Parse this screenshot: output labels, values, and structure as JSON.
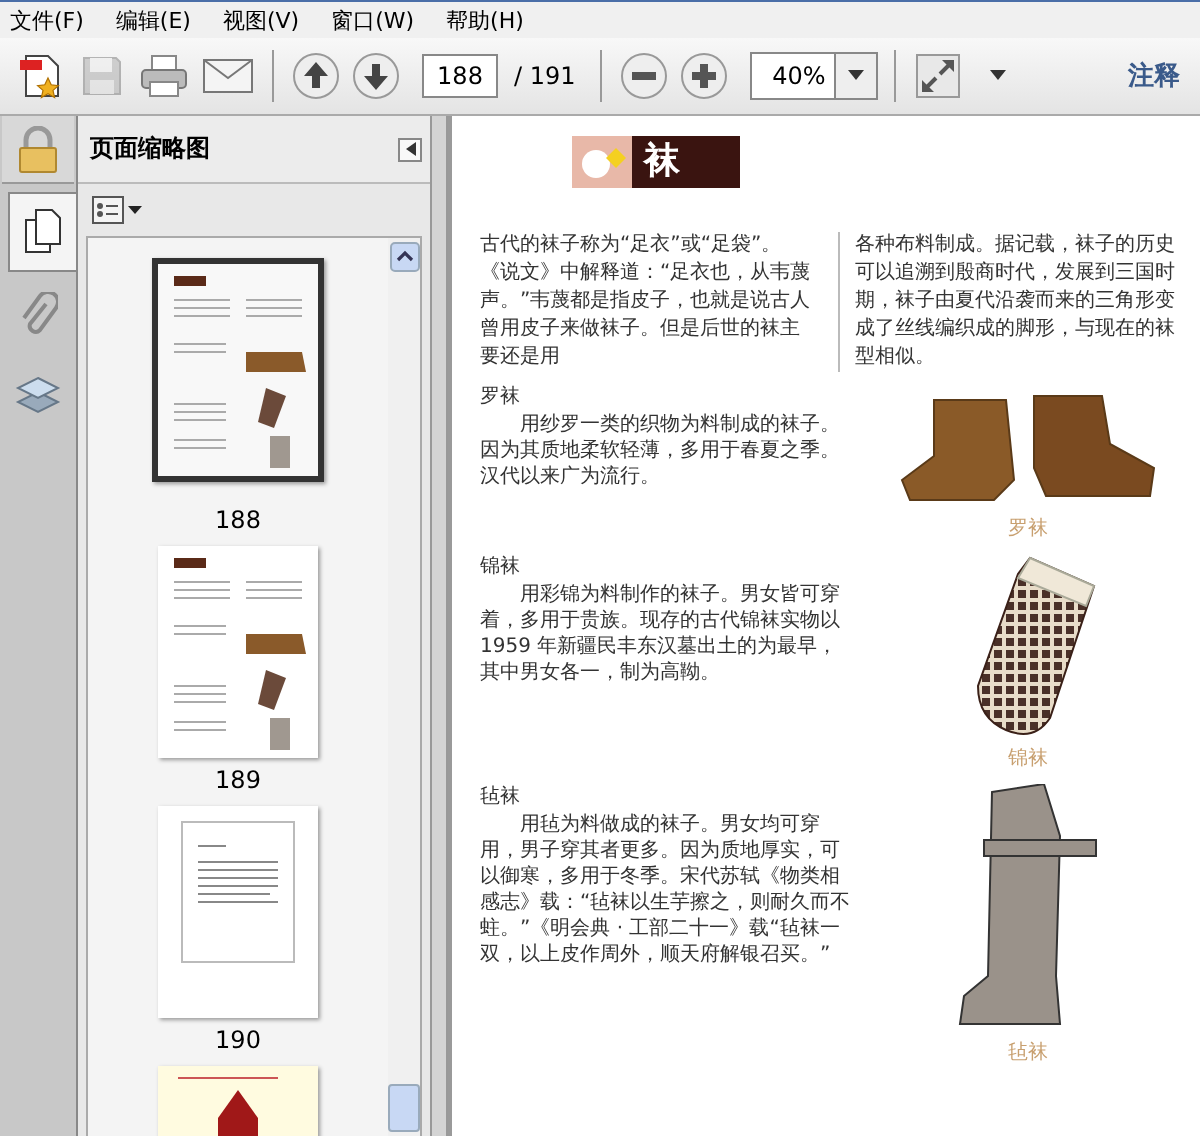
{
  "menu": [
    {
      "label": "文件(F)"
    },
    {
      "label": "编辑(E)"
    },
    {
      "label": "视图(V)"
    },
    {
      "label": "窗口(W)"
    },
    {
      "label": "帮助(H)"
    }
  ],
  "toolbar": {
    "file_tools": [
      {
        "kind": "create-pdf",
        "disabled": false
      },
      {
        "kind": "save",
        "disabled": true
      },
      {
        "kind": "print",
        "disabled": false
      },
      {
        "kind": "email",
        "disabled": false
      }
    ],
    "nav_tools": [
      {
        "kind": "previous-page",
        "disabled": false
      },
      {
        "kind": "next-page",
        "disabled": false
      }
    ],
    "page_field": {
      "value": "188"
    },
    "page_count": "/ 191",
    "zoom_tools": [
      {
        "kind": "zoom-out",
        "disabled": false
      },
      {
        "kind": "zoom-in",
        "disabled": false
      }
    ],
    "zoom_field": {
      "value": "40%"
    },
    "view_tools": [
      {
        "kind": "full-screen",
        "disabled": false
      },
      {
        "kind": "more",
        "disabled": false
      }
    ],
    "comment_button": "注释"
  },
  "sidebar": {
    "tabs": [
      {
        "kind": "security",
        "selected": false
      },
      {
        "kind": "pages",
        "selected": true
      },
      {
        "kind": "attachments",
        "selected": false
      },
      {
        "kind": "layers",
        "selected": false
      }
    ],
    "panel_title": "页面缩略图",
    "thumbnails": [
      {
        "kind": "pictures",
        "label": "188",
        "selected": true
      },
      {
        "kind": "pictures",
        "label": "189",
        "selected": false
      },
      {
        "kind": "text",
        "label": "190",
        "selected": false
      },
      {
        "kind": "red-figure",
        "selected": false
      }
    ]
  },
  "document": {
    "title": "袜",
    "intro": [
      "古代的袜子称为“足衣”或“足袋”。《说文》中解释道：“足衣也，从韦蔑声。”韦蔑都是指皮子，也就是说古人曾用皮子来做袜子。但是后世的袜主要还是用",
      "各种布料制成。据记载，袜子的历史可以追溯到殷商时代，发展到三国时期，袜子由夏代沿袭而来的三角形变成了丝线编织成的脚形，与现在的袜型相似。"
    ],
    "sections": [
      {
        "kind": "socks",
        "heading": "罗袜",
        "text": "用纱罗一类的织物为料制成的袜子。因为其质地柔软轻薄，多用于春夏之季。汉代以来广为流行。",
        "caption": "罗袜"
      },
      {
        "kind": "sock",
        "heading": "锦袜",
        "text": "用彩锦为料制作的袜子。男女皆可穿着，多用于贵族。现存的古代锦袜实物以 1959 年新疆民丰东汉墓出土的为最早，其中男女各一，制为高靿。",
        "caption": "锦袜"
      },
      {
        "kind": "boot",
        "heading": "毡袜",
        "text": "用毡为料做成的袜子。男女均可穿用，男子穿其者更多。因为质地厚实，可以御寒，多用于冬季。宋代苏轼《物类相感志》载：“毡袜以生芋擦之，则耐久而不蛀。”《明会典 · 工部二十一》载“毡袜一双，以上皮作周外，顺天府解银召买。”",
        "caption": "毡袜"
      }
    ]
  }
}
